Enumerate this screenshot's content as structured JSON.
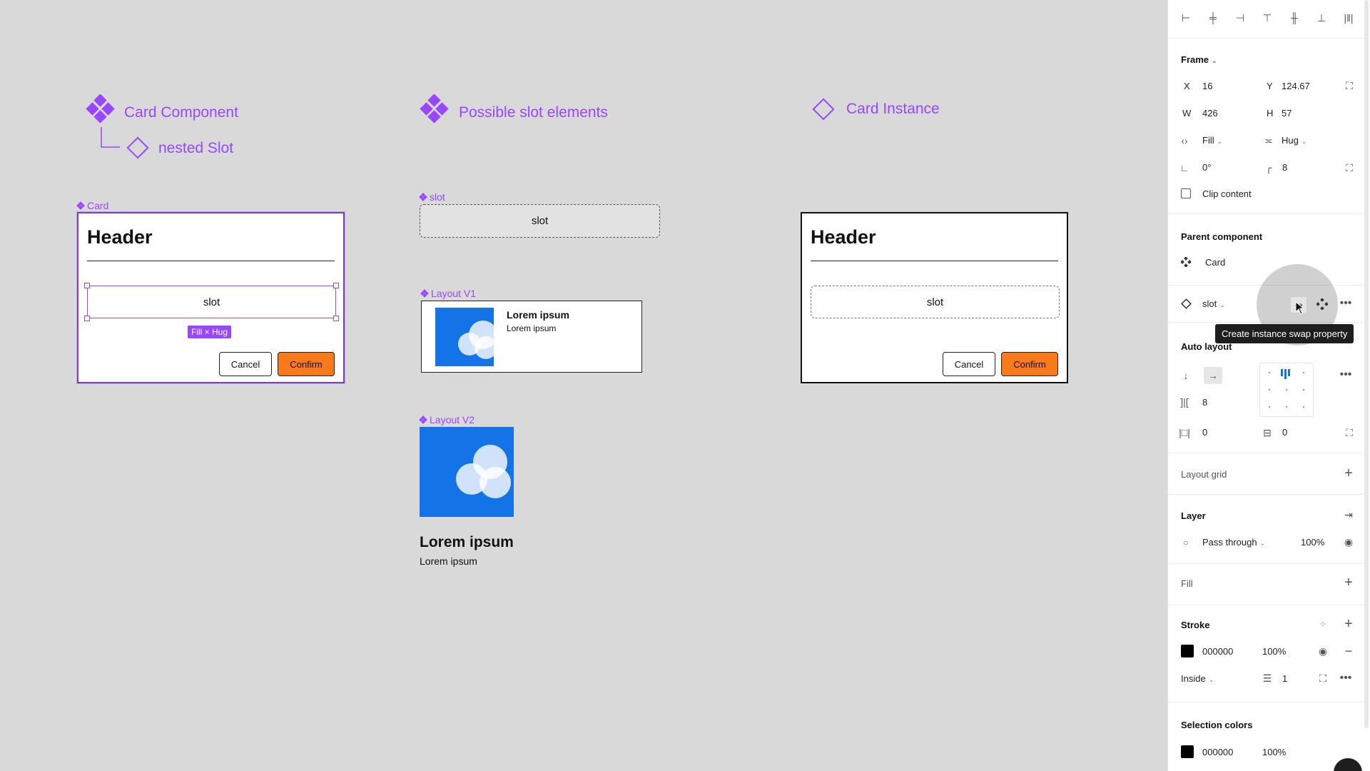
{
  "canvas": {
    "legend": {
      "card_component": "Card Component",
      "nested_slot": "nested Slot",
      "possible_slot_elements": "Possible slot elements",
      "card_instance": "Card Instance"
    },
    "card_component": {
      "frame_label": "Card",
      "header": "Header",
      "slot_text": "slot",
      "size_badge": "Fill × Hug",
      "cancel": "Cancel",
      "confirm": "Confirm"
    },
    "slot_frame": {
      "frame_label": "slot",
      "slot_text": "slot"
    },
    "layout_v1": {
      "frame_label": "Layout V1",
      "title": "Lorem ipsum",
      "subtitle": "Lorem ipsum"
    },
    "layout_v2": {
      "frame_label": "Layout V2",
      "title": "Lorem ipsum",
      "subtitle": "Lorem ipsum"
    },
    "card_instance": {
      "header": "Header",
      "slot_text": "slot",
      "cancel": "Cancel",
      "confirm": "Confirm"
    }
  },
  "panel": {
    "frame": {
      "title": "Frame",
      "x_label": "X",
      "x_value": "16",
      "y_label": "Y",
      "y_value": "124.67",
      "w_label": "W",
      "w_value": "426",
      "h_label": "H",
      "h_value": "57",
      "width_mode": "Fill",
      "height_mode": "Hug",
      "rotation": "0°",
      "radius": "8",
      "clip_content": "Clip content"
    },
    "parent_component": {
      "title": "Parent component",
      "name": "Card"
    },
    "instance": {
      "name": "slot",
      "tooltip": "Create instance swap property"
    },
    "auto_layout": {
      "title": "Auto layout",
      "gap": "8",
      "padding_h": "0",
      "padding_v": "0"
    },
    "layout_grid": {
      "title": "Layout grid"
    },
    "layer": {
      "title": "Layer",
      "blend": "Pass through",
      "opacity": "100%"
    },
    "fill": {
      "title": "Fill"
    },
    "stroke": {
      "title": "Stroke",
      "color": "000000",
      "opacity": "100%",
      "position": "Inside",
      "weight": "1"
    },
    "selection_colors": {
      "title": "Selection colors",
      "color": "000000",
      "opacity": "100%"
    }
  },
  "colors": {
    "component_purple": "#9747ff",
    "confirm_orange": "#f97a1b",
    "image_blue": "#1473e6",
    "canvas_bg": "#d9d9d9"
  }
}
